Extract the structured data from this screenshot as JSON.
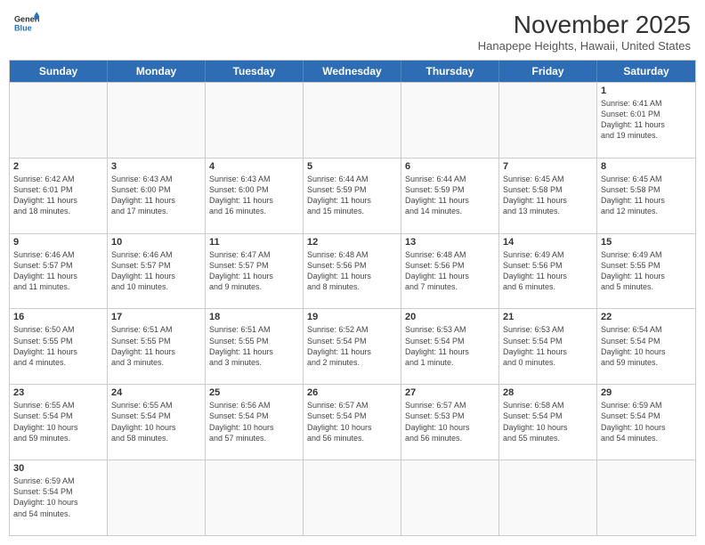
{
  "header": {
    "logo_general": "General",
    "logo_blue": "Blue",
    "month_year": "November 2025",
    "location": "Hanapepe Heights, Hawaii, United States"
  },
  "days_of_week": [
    "Sunday",
    "Monday",
    "Tuesday",
    "Wednesday",
    "Thursday",
    "Friday",
    "Saturday"
  ],
  "rows": [
    [
      {
        "day": "",
        "info": ""
      },
      {
        "day": "",
        "info": ""
      },
      {
        "day": "",
        "info": ""
      },
      {
        "day": "",
        "info": ""
      },
      {
        "day": "",
        "info": ""
      },
      {
        "day": "",
        "info": ""
      },
      {
        "day": "1",
        "info": "Sunrise: 6:41 AM\nSunset: 6:01 PM\nDaylight: 11 hours\nand 19 minutes."
      }
    ],
    [
      {
        "day": "2",
        "info": "Sunrise: 6:42 AM\nSunset: 6:01 PM\nDaylight: 11 hours\nand 18 minutes."
      },
      {
        "day": "3",
        "info": "Sunrise: 6:43 AM\nSunset: 6:00 PM\nDaylight: 11 hours\nand 17 minutes."
      },
      {
        "day": "4",
        "info": "Sunrise: 6:43 AM\nSunset: 6:00 PM\nDaylight: 11 hours\nand 16 minutes."
      },
      {
        "day": "5",
        "info": "Sunrise: 6:44 AM\nSunset: 5:59 PM\nDaylight: 11 hours\nand 15 minutes."
      },
      {
        "day": "6",
        "info": "Sunrise: 6:44 AM\nSunset: 5:59 PM\nDaylight: 11 hours\nand 14 minutes."
      },
      {
        "day": "7",
        "info": "Sunrise: 6:45 AM\nSunset: 5:58 PM\nDaylight: 11 hours\nand 13 minutes."
      },
      {
        "day": "8",
        "info": "Sunrise: 6:45 AM\nSunset: 5:58 PM\nDaylight: 11 hours\nand 12 minutes."
      }
    ],
    [
      {
        "day": "9",
        "info": "Sunrise: 6:46 AM\nSunset: 5:57 PM\nDaylight: 11 hours\nand 11 minutes."
      },
      {
        "day": "10",
        "info": "Sunrise: 6:46 AM\nSunset: 5:57 PM\nDaylight: 11 hours\nand 10 minutes."
      },
      {
        "day": "11",
        "info": "Sunrise: 6:47 AM\nSunset: 5:57 PM\nDaylight: 11 hours\nand 9 minutes."
      },
      {
        "day": "12",
        "info": "Sunrise: 6:48 AM\nSunset: 5:56 PM\nDaylight: 11 hours\nand 8 minutes."
      },
      {
        "day": "13",
        "info": "Sunrise: 6:48 AM\nSunset: 5:56 PM\nDaylight: 11 hours\nand 7 minutes."
      },
      {
        "day": "14",
        "info": "Sunrise: 6:49 AM\nSunset: 5:56 PM\nDaylight: 11 hours\nand 6 minutes."
      },
      {
        "day": "15",
        "info": "Sunrise: 6:49 AM\nSunset: 5:55 PM\nDaylight: 11 hours\nand 5 minutes."
      }
    ],
    [
      {
        "day": "16",
        "info": "Sunrise: 6:50 AM\nSunset: 5:55 PM\nDaylight: 11 hours\nand 4 minutes."
      },
      {
        "day": "17",
        "info": "Sunrise: 6:51 AM\nSunset: 5:55 PM\nDaylight: 11 hours\nand 3 minutes."
      },
      {
        "day": "18",
        "info": "Sunrise: 6:51 AM\nSunset: 5:55 PM\nDaylight: 11 hours\nand 3 minutes."
      },
      {
        "day": "19",
        "info": "Sunrise: 6:52 AM\nSunset: 5:54 PM\nDaylight: 11 hours\nand 2 minutes."
      },
      {
        "day": "20",
        "info": "Sunrise: 6:53 AM\nSunset: 5:54 PM\nDaylight: 11 hours\nand 1 minute."
      },
      {
        "day": "21",
        "info": "Sunrise: 6:53 AM\nSunset: 5:54 PM\nDaylight: 11 hours\nand 0 minutes."
      },
      {
        "day": "22",
        "info": "Sunrise: 6:54 AM\nSunset: 5:54 PM\nDaylight: 10 hours\nand 59 minutes."
      }
    ],
    [
      {
        "day": "23",
        "info": "Sunrise: 6:55 AM\nSunset: 5:54 PM\nDaylight: 10 hours\nand 59 minutes."
      },
      {
        "day": "24",
        "info": "Sunrise: 6:55 AM\nSunset: 5:54 PM\nDaylight: 10 hours\nand 58 minutes."
      },
      {
        "day": "25",
        "info": "Sunrise: 6:56 AM\nSunset: 5:54 PM\nDaylight: 10 hours\nand 57 minutes."
      },
      {
        "day": "26",
        "info": "Sunrise: 6:57 AM\nSunset: 5:54 PM\nDaylight: 10 hours\nand 56 minutes."
      },
      {
        "day": "27",
        "info": "Sunrise: 6:57 AM\nSunset: 5:53 PM\nDaylight: 10 hours\nand 56 minutes."
      },
      {
        "day": "28",
        "info": "Sunrise: 6:58 AM\nSunset: 5:54 PM\nDaylight: 10 hours\nand 55 minutes."
      },
      {
        "day": "29",
        "info": "Sunrise: 6:59 AM\nSunset: 5:54 PM\nDaylight: 10 hours\nand 54 minutes."
      }
    ],
    [
      {
        "day": "30",
        "info": "Sunrise: 6:59 AM\nSunset: 5:54 PM\nDaylight: 10 hours\nand 54 minutes."
      },
      {
        "day": "",
        "info": ""
      },
      {
        "day": "",
        "info": ""
      },
      {
        "day": "",
        "info": ""
      },
      {
        "day": "",
        "info": ""
      },
      {
        "day": "",
        "info": ""
      },
      {
        "day": "",
        "info": ""
      }
    ]
  ]
}
